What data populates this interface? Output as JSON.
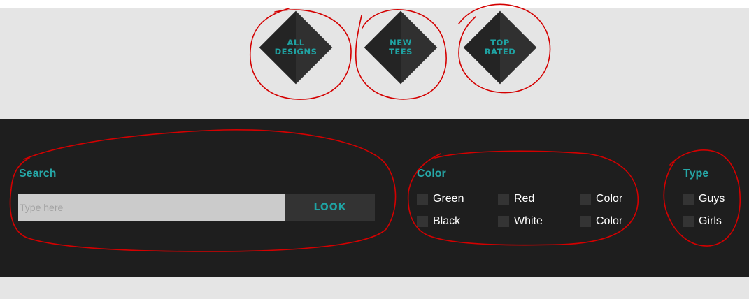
{
  "nav": {
    "items": [
      {
        "id": "all",
        "label": "ALL\nDESIGNS"
      },
      {
        "id": "new",
        "label": "NEW\nTEES"
      },
      {
        "id": "top",
        "label": "TOP\nRATED"
      }
    ]
  },
  "search": {
    "title": "Search",
    "placeholder": "Type here",
    "button_label": "LOOK"
  },
  "color_filter": {
    "title": "Color",
    "options": [
      "Green",
      "Red",
      "Color",
      "Black",
      "White",
      "Color"
    ]
  },
  "type_filter": {
    "title": "Type",
    "options": [
      "Guys",
      "Girls"
    ]
  },
  "colors": {
    "accent": "#26a8a8",
    "annotation": "#d40000",
    "bar_background": "#1e1e1e",
    "light_band": "#e5e5e5"
  }
}
